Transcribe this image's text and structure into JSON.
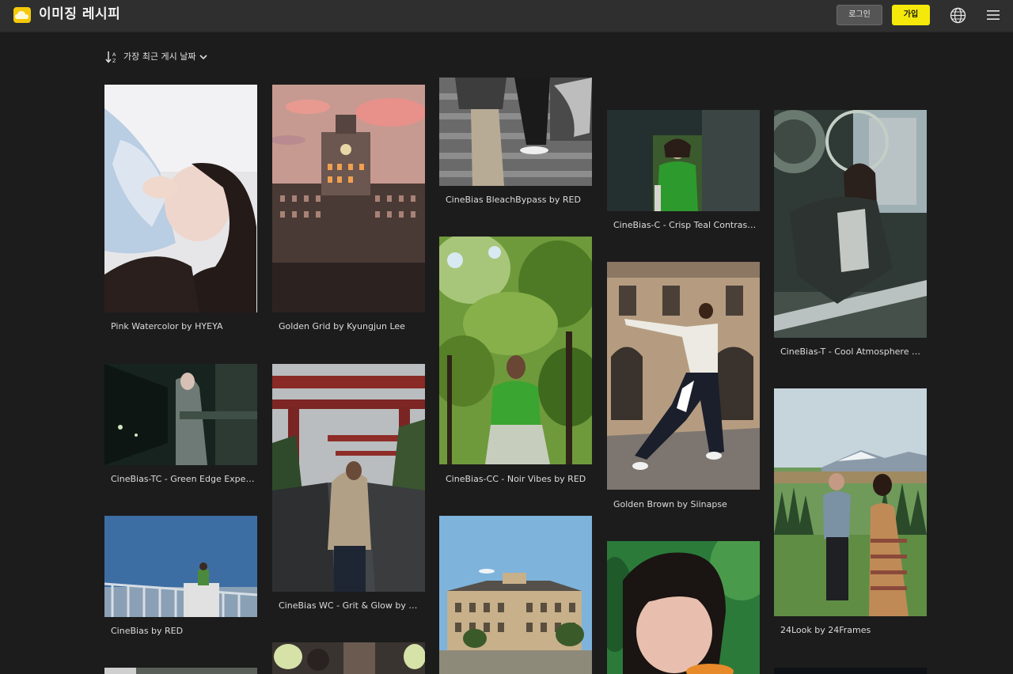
{
  "header": {
    "brand": "이미징 레시피",
    "login_label": "로그인",
    "signup_label": "가입",
    "accent_color": "#f4e90a"
  },
  "sort": {
    "label": "가장 최근 게시 날짜",
    "icon": "sort-descending-icon"
  },
  "cards": [
    {
      "title": "Pink Watercolor by HYEYA"
    },
    {
      "title": "Golden Grid by Kyungjun Lee"
    },
    {
      "title": "CineBias BleachBypass by RED"
    },
    {
      "title": "CineBias-C - Crisp Teal Contrast ..."
    },
    {
      "title": "CineBias-T - Cool Atmosphere b..."
    },
    {
      "title": "CineBias-TC - Green Edge Experi..."
    },
    {
      "title": "CineBias WC - Grit & Glow by R..."
    },
    {
      "title": "CineBias-CC - Noir Vibes by RED"
    },
    {
      "title": "Golden Brown by Siinapse"
    },
    {
      "title": "CineBias by RED"
    },
    {
      "title": "24Look by 24Frames"
    }
  ]
}
